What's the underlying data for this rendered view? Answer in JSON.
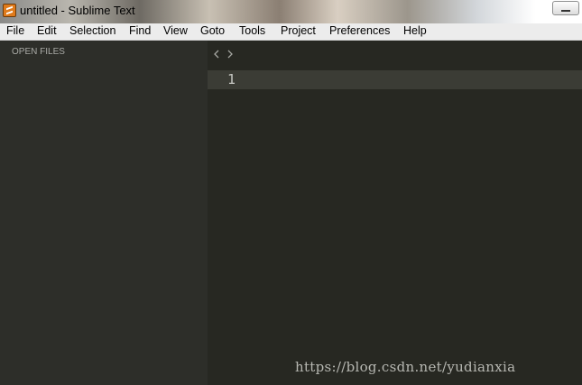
{
  "window": {
    "title": "untitled - Sublime Text",
    "app_icon": "sublime-text-icon"
  },
  "menu": {
    "items": [
      "File",
      "Edit",
      "Selection",
      "Find",
      "View",
      "Goto",
      "Tools",
      "Project",
      "Preferences",
      "Help"
    ]
  },
  "sidebar": {
    "heading": "OPEN FILES"
  },
  "editor": {
    "nav_icons": [
      "chevron-left-icon",
      "chevron-right-icon"
    ],
    "line_numbers": [
      "1"
    ],
    "watermark": "https://blog.csdn.net/yudianxia"
  },
  "colors": {
    "editor_bg": "#272822",
    "sidebar_bg": "#2d2e29",
    "current_line": "#3b3c35",
    "menubar_bg": "#ececec"
  }
}
